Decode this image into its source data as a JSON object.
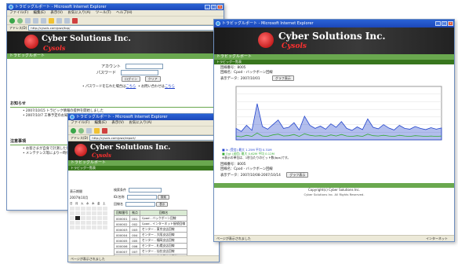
{
  "browser": {
    "menu": [
      "ファイル(F)",
      "編集(E)",
      "表示(V)",
      "お気に入り(A)",
      "ツール(T)",
      "ヘルプ(H)"
    ],
    "address_label": "アドレス(D)",
    "status_text": "ページが表示されました"
  },
  "win1": {
    "title": "トラビッグルポート - Microsoft Internet Explorer",
    "url": "http://cysols.com/pwz/top/",
    "brand": {
      "name": "Cyber Solutions Inc.",
      "sub": "Cysols"
    },
    "green_title": "トラビッグルポート",
    "login": {
      "account_label": "アカウント",
      "password_label": "パスワード",
      "login_button": "ログイン",
      "clear_button": "クリア",
      "forgot_text": "パスワードを忘れた場合は",
      "forgot_link": "こちら",
      "contact_text": "お問い合わせは",
      "contact_link": "こちら"
    },
    "notice_head": "お知らせ",
    "notices": [
      "2007/10/15 トラビック情報の提供を開始しました",
      "2007/10/7 工事予定のお知らせ"
    ],
    "caution_head": "注意事項",
    "cautions": [
      "お客さまが自身で計測した値であります",
      "メンテナンス等により一時停止する場合"
    ]
  },
  "win2": {
    "title": "トラビッグルポート - Microsoft Internet Explorer",
    "url": "http://cysols.com/pwz/report/",
    "brand": {
      "name": "Cyber Solutions Inc.",
      "sub": "Cysols"
    },
    "green_title": "トラビッグルポート",
    "subbar": "トラビッグ一覧表",
    "left_panel": {
      "head": "表示期間",
      "month": "2007年10月",
      "days": [
        "日",
        "月",
        "火",
        "水",
        "木",
        "金",
        "土"
      ]
    },
    "form": {
      "labels": [
        "検索条件",
        "ID/名称",
        "回線名"
      ],
      "button": "検索",
      "button2": "表示"
    },
    "table": {
      "headers": [
        "回線番号",
        "拠点",
        "回線名"
      ],
      "rows": [
        [
          "000001",
          "001",
          "Cpod - バックボーン回線"
        ],
        [
          "000002",
          "002",
          "Cpod - インターネット接続回線"
        ],
        [
          "000003",
          "003",
          "センター - 東京支店回線"
        ],
        [
          "000004",
          "004",
          "センター - 大阪支店回線"
        ],
        [
          "000005",
          "005",
          "センター - 福岡支店回線"
        ],
        [
          "000006",
          "006",
          "センター - 札幌支店回線"
        ],
        [
          "000007",
          "007",
          "センター - 仙台支店回線"
        ],
        [
          "000008",
          "008",
          "センター - 名古屋支店回線"
        ]
      ]
    },
    "status_text": "ページが表示されました"
  },
  "win3": {
    "title": "トラビッグルポート - Microsoft Internet Explorer",
    "url": "http://cysols.com/pwz/graph/",
    "brand": {
      "name": "Cyber Solutions Inc.",
      "sub": "Cysols"
    },
    "green_title": "トラビッグルポート",
    "subbar": "トラビッグ一覧表",
    "block1": {
      "line1": "回線番号：8005",
      "line2": "回線名：Cpod - バックボーン回線",
      "line3": "表示データ：2007/10/01",
      "button": "グラフ表示"
    },
    "block2": {
      "line1": "回線番号：8005",
      "line2": "回線名：Cpod - バックボーン回線",
      "line3": "表示データ：2007/10/08-2007/10/14",
      "button": "グラフ表示"
    },
    "legend": [
      "■ In (受信)  最大 1.25M 平均 0.31M",
      "■ Out (送信)  最大 0.62M 平均 0.12M"
    ],
    "note": "※表示の単位は、1秒当たりのビット数(bps)です。",
    "footer": "Copyright(c) Cyber Solutions Inc.",
    "footer2": "Cyber Solutions Inc.  All Rights Reserved.",
    "status_text": "ページが表示されました",
    "status_right": "インターネット"
  },
  "chart_data": {
    "type": "area",
    "title": "",
    "xlabel": "",
    "ylabel": "",
    "ylim": [
      0,
      1.4
    ],
    "series": [
      {
        "name": "In",
        "values": [
          0.3,
          0.22,
          0.38,
          0.25,
          0.95,
          0.35,
          0.28,
          0.4,
          0.52,
          0.3,
          0.33,
          0.45,
          0.26,
          0.62,
          0.38,
          0.3,
          0.36,
          0.28,
          0.42,
          0.33,
          0.48,
          0.3,
          0.25,
          0.34,
          0.27,
          0.55,
          0.33,
          0.29,
          0.4,
          0.31,
          0.26,
          0.38,
          0.3,
          0.28,
          0.35,
          0.3,
          0.27,
          0.32,
          0.28,
          0.31
        ]
      },
      {
        "name": "Out",
        "values": [
          0.1,
          0.08,
          0.12,
          0.09,
          0.18,
          0.1,
          0.09,
          0.13,
          0.15,
          0.1,
          0.11,
          0.14,
          0.09,
          0.16,
          0.12,
          0.1,
          0.11,
          0.09,
          0.13,
          0.1,
          0.14,
          0.1,
          0.09,
          0.11,
          0.09,
          0.15,
          0.11,
          0.1,
          0.12,
          0.1,
          0.09,
          0.12,
          0.1,
          0.09,
          0.11,
          0.1,
          0.09,
          0.1,
          0.09,
          0.1
        ]
      }
    ],
    "colors": {
      "in": "#2244cc",
      "out": "#33aa33"
    }
  }
}
